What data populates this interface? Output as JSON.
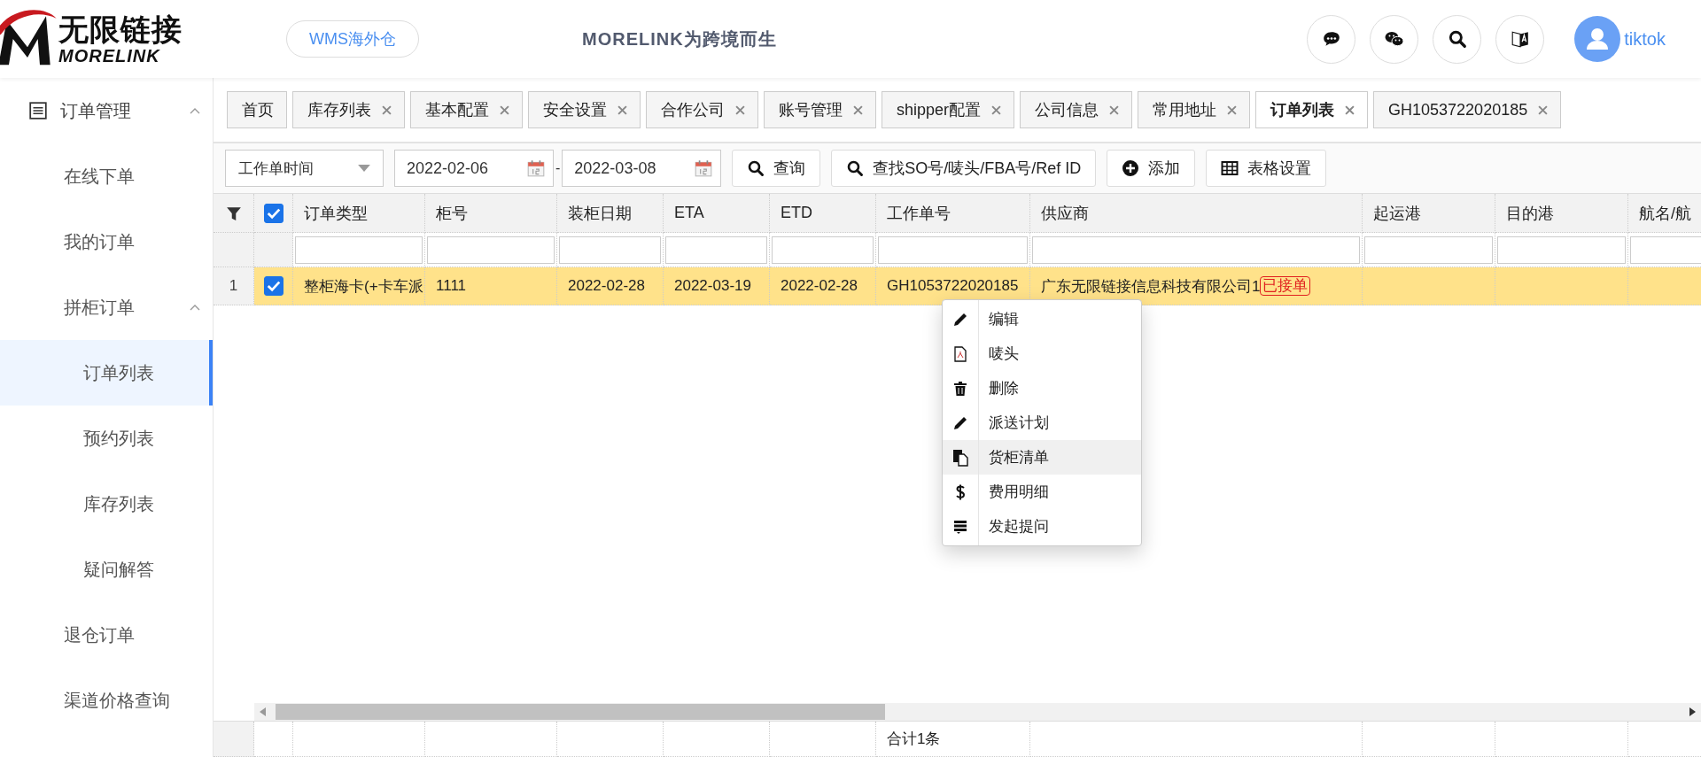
{
  "header": {
    "logo": {
      "name_cn": "无限链接",
      "name_en": "MORELINK"
    },
    "warehouse_button": "WMS海外仓",
    "slogan": "MORELINK为跨境而生",
    "tools": [
      {
        "kind": "chat"
      },
      {
        "kind": "wechat"
      },
      {
        "kind": "search"
      },
      {
        "kind": "translate"
      }
    ],
    "user": "tiktok"
  },
  "sidebar": {
    "items": [
      {
        "label": "订单管理",
        "icon": true,
        "expanded": true,
        "selected": false,
        "children": [
          {
            "label": "在线下单",
            "selected": false
          },
          {
            "label": "我的订单",
            "selected": false
          },
          {
            "label": "拼柜订单",
            "expanded": true,
            "selected": false,
            "children": [
              {
                "label": "订单列表",
                "selected": true
              },
              {
                "label": "预约列表",
                "selected": false
              },
              {
                "label": "库存列表",
                "selected": false
              },
              {
                "label": "疑问解答",
                "selected": false
              }
            ]
          },
          {
            "label": "退仓订单",
            "selected": false
          },
          {
            "label": "渠道价格查询",
            "selected": false
          }
        ]
      }
    ]
  },
  "tabs": [
    {
      "label": "首页",
      "closable": false,
      "selected": false
    },
    {
      "label": "库存列表",
      "closable": true,
      "selected": false
    },
    {
      "label": "基本配置",
      "closable": true,
      "selected": false
    },
    {
      "label": "安全设置",
      "closable": true,
      "selected": false
    },
    {
      "label": "合作公司",
      "closable": true,
      "selected": false
    },
    {
      "label": "账号管理",
      "closable": true,
      "selected": false
    },
    {
      "label": "shipper配置",
      "closable": true,
      "selected": false
    },
    {
      "label": "公司信息",
      "closable": true,
      "selected": false
    },
    {
      "label": "常用地址",
      "closable": true,
      "selected": false
    },
    {
      "label": "订单列表",
      "closable": true,
      "selected": true
    },
    {
      "label": "GH1053722020185",
      "closable": true,
      "selected": false
    }
  ],
  "toolbar": {
    "date_type": "工作单时间",
    "date_from": "2022-02-06",
    "separator": "-",
    "date_to": "2022-03-08",
    "buttons": [
      {
        "kind": "search",
        "label": "查询"
      },
      {
        "kind": "search",
        "label": "查找SO号/唛头/FBA号/Ref ID"
      },
      {
        "kind": "add",
        "label": "添加"
      },
      {
        "kind": "table",
        "label": "表格设置"
      }
    ]
  },
  "table": {
    "all_checked": true,
    "columns": [
      "订单类型",
      "柜号",
      "装柜日期",
      "ETA",
      "ETD",
      "工作单号",
      "供应商",
      "起运港",
      "目的港",
      "航名/航"
    ],
    "rows": [
      {
        "number": "1",
        "selected": true,
        "cells": [
          "整柜海卡(+卡车派",
          "1111",
          "2022-02-28",
          "2022-03-19",
          "2022-02-28",
          "GH1053722020185",
          "广东无限链接信息科技有限公司1",
          "",
          "",
          ""
        ],
        "status": "已接单"
      }
    ],
    "footer": "合计1条"
  },
  "context_menu": [
    {
      "kind": "pencil",
      "label": "编辑",
      "selected": false
    },
    {
      "kind": "pdf",
      "label": "唛头",
      "selected": false
    },
    {
      "kind": "trash",
      "label": "删除",
      "selected": false
    },
    {
      "kind": "pencil",
      "label": "派送计划",
      "selected": false
    },
    {
      "kind": "copy",
      "label": "货柜清单",
      "selected": true
    },
    {
      "kind": "dollar",
      "label": "费用明细",
      "selected": false
    },
    {
      "kind": "list",
      "label": "发起提问",
      "selected": false
    }
  ]
}
